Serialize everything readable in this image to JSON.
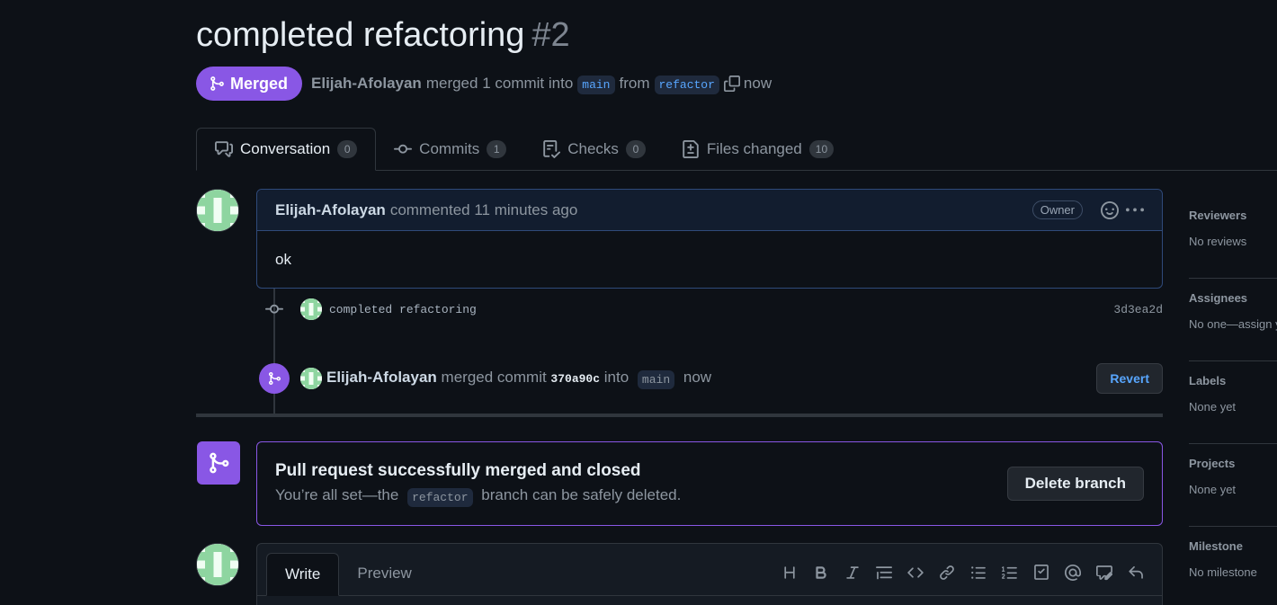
{
  "pr": {
    "title": "completed refactoring",
    "number": "#2",
    "state": "Merged",
    "author": "Elijah-Afolayan",
    "action": "merged 1 commit into",
    "base_branch": "main",
    "from_word": "from",
    "head_branch": "refactor",
    "time": "now"
  },
  "tabs": [
    {
      "label": "Conversation",
      "count": "0",
      "icon": "comment-discussion-icon"
    },
    {
      "label": "Commits",
      "count": "1",
      "icon": "git-commit-icon"
    },
    {
      "label": "Checks",
      "count": "0",
      "icon": "checklist-icon"
    },
    {
      "label": "Files changed",
      "count": "10",
      "icon": "file-diff-icon"
    }
  ],
  "comment": {
    "author": "Elijah-Afolayan",
    "action": "commented 11 minutes ago",
    "role": "Owner",
    "body": "ok"
  },
  "commit": {
    "message": "completed refactoring",
    "sha": "3d3ea2d"
  },
  "merge_event": {
    "author": "Elijah-Afolayan",
    "action": "merged commit",
    "sha": "370a90c",
    "into": "into",
    "branch": "main",
    "time": "now",
    "revert_label": "Revert"
  },
  "merged_box": {
    "title": "Pull request successfully merged and closed",
    "sub_before": "You’re all set—the",
    "branch": "refactor",
    "sub_after": "branch can be safely deleted.",
    "delete_label": "Delete branch"
  },
  "reply": {
    "write_label": "Write",
    "preview_label": "Preview",
    "toolbar": [
      "heading-icon",
      "bold-icon",
      "italic-icon",
      "quote-icon",
      "code-icon",
      "link-icon",
      "unordered-list-icon",
      "ordered-list-icon",
      "task-list-icon",
      "mention-icon",
      "reference-icon",
      "undo-icon"
    ]
  },
  "sidebar": [
    {
      "title": "Reviewers",
      "value": "No reviews"
    },
    {
      "title": "Assignees",
      "value": "No one—assign yourself"
    },
    {
      "title": "Labels",
      "value": "None yet"
    },
    {
      "title": "Projects",
      "value": "None yet"
    },
    {
      "title": "Milestone",
      "value": "No milestone"
    }
  ],
  "colors": {
    "background": "#0d1117",
    "merged_purple": "#8957e5",
    "link_blue": "#58a6ff",
    "border": "#30363d"
  }
}
